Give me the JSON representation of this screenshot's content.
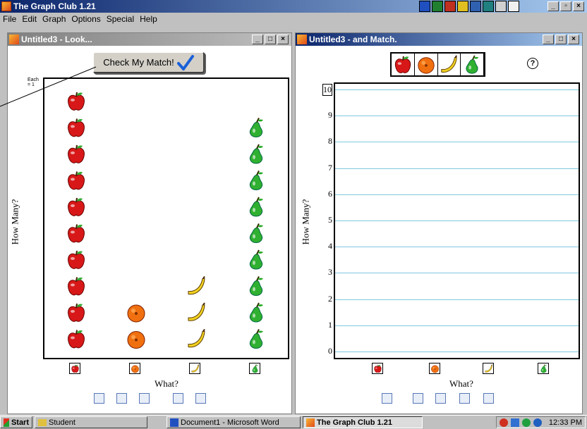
{
  "app": {
    "title": "The Graph Club 1.21"
  },
  "menu": [
    "File",
    "Edit",
    "Graph",
    "Options",
    "Special",
    "Help"
  ],
  "left_pane": {
    "title": "Untitled3 - Look...",
    "each_label": "Each\n= 1",
    "ylabel": "How Many?",
    "xlabel": "What?",
    "check_button": "Check My Match!"
  },
  "right_pane": {
    "title": "Untitled3 - and Match.",
    "ylabel": "How Many?",
    "xlabel": "What?",
    "help_icon": "?"
  },
  "chart_data": [
    {
      "type": "bar",
      "categories": [
        "apple",
        "orange",
        "banana",
        "pear"
      ],
      "values": [
        10,
        2,
        3,
        9
      ],
      "title": "",
      "xlabel": "What?",
      "ylabel": "How Many?"
    },
    {
      "type": "bar",
      "categories": [
        "apple",
        "orange",
        "banana",
        "pear"
      ],
      "values": [
        0,
        0,
        0,
        0
      ],
      "ylim": [
        0,
        10
      ],
      "yticks": [
        0,
        1,
        2,
        3,
        4,
        5,
        6,
        7,
        8,
        9,
        10
      ],
      "xlabel": "What?",
      "ylabel": "How Many?"
    }
  ],
  "taskbar": {
    "start": "Start",
    "items": [
      "Student",
      "Document1 - Microsoft Word",
      "The Graph Club 1.21"
    ],
    "clock": "12:33 PM"
  },
  "colors": {
    "apple": "#d81818",
    "orange": "#f07010",
    "banana": "#f0d020",
    "pear": "#30b030",
    "grid": "#80c8e0"
  }
}
